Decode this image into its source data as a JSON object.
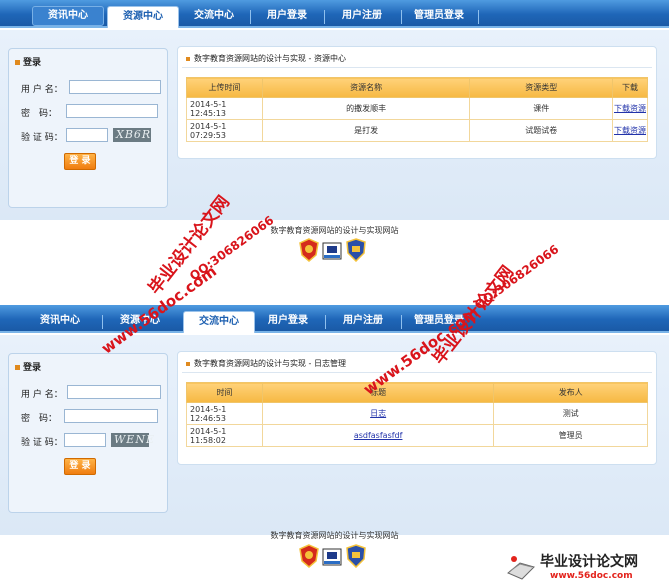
{
  "screen1": {
    "nav": [
      "资讯中心",
      "资源中心",
      "交流中心",
      "用户登录",
      "用户注册",
      "管理员登录"
    ],
    "active_tab": "资源中心",
    "login": {
      "title": "登录",
      "username_label": "用 户 名：",
      "password_label": "密　码：",
      "captcha_label": "验 证 码：",
      "captcha_value": "XB6R",
      "button": "登 录"
    },
    "main_title": "数字教育资源网站的设计与实现 - 资源中心",
    "table": {
      "headers": [
        "上传时间",
        "资源名称",
        "资源类型",
        "下载"
      ],
      "rows": [
        [
          "2014-5-1 12:45:13",
          "的撒发顺丰",
          "课件",
          "下载资源"
        ],
        [
          "2014-5-1 07:29:53",
          "是打发",
          "试题试卷",
          "下载资源"
        ]
      ]
    },
    "footer": "数字教育资源网站的设计与实现网站"
  },
  "screen2": {
    "nav": [
      "资讯中心",
      "资源中心",
      "交流中心",
      "用户登录",
      "用户注册",
      "管理员登录"
    ],
    "active_tab": "交流中心",
    "login": {
      "title": "登录",
      "username_label": "用 户 名：",
      "password_label": "密　码：",
      "captcha_label": "验 证 码：",
      "captcha_value": "WENE",
      "button": "登 录"
    },
    "main_title": "数字教育资源网站的设计与实现 - 日志管理",
    "table": {
      "headers": [
        "时间",
        "标题",
        "发布人"
      ],
      "rows": [
        [
          "2014-5-1 12:46:53",
          "日志",
          "测试"
        ],
        [
          "2014-5-1 11:58:02",
          "asdfasfasfdf",
          "管理员"
        ]
      ]
    },
    "footer": "数字教育资源网站的设计与实现网站"
  },
  "watermarks": {
    "site": "www.56doc.com",
    "qq": "QQ:306826066",
    "name": "毕业设计论文网",
    "color": "#d9141b"
  },
  "brand": {
    "name": "毕业设计论文网",
    "url": "www.56doc.com"
  },
  "colors": {
    "nav_blue": "#1f66b8",
    "table_header": "#f6b842",
    "button_orange": "#f07d10"
  }
}
